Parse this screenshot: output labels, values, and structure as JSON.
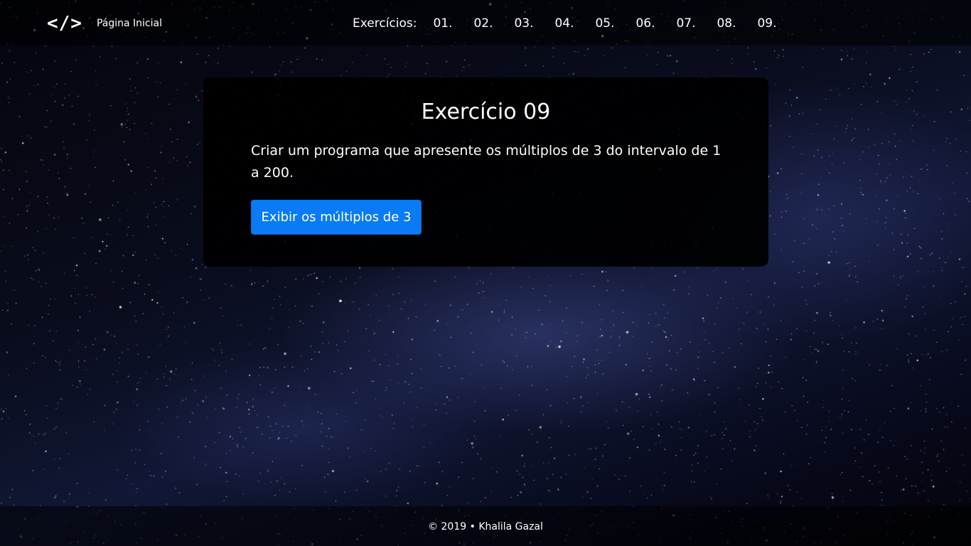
{
  "header": {
    "brand_icon": "</>",
    "home_label": "Página Inicial",
    "exercises_label": "Exercícios:",
    "exercise_links": [
      "01.",
      "02.",
      "03.",
      "04.",
      "05.",
      "06.",
      "07.",
      "08.",
      "09."
    ]
  },
  "card": {
    "title": "Exercício 09",
    "description": "Criar um programa que apresente os múltiplos de 3 do intervalo de 1 a 200.",
    "button_label": "Exibir os múltiplos de 3"
  },
  "footer": {
    "text": "© 2019 • Khalila Gazal"
  },
  "colors": {
    "button": "#0a7bf5",
    "card_background": "#000000",
    "text": "#ffffff"
  }
}
